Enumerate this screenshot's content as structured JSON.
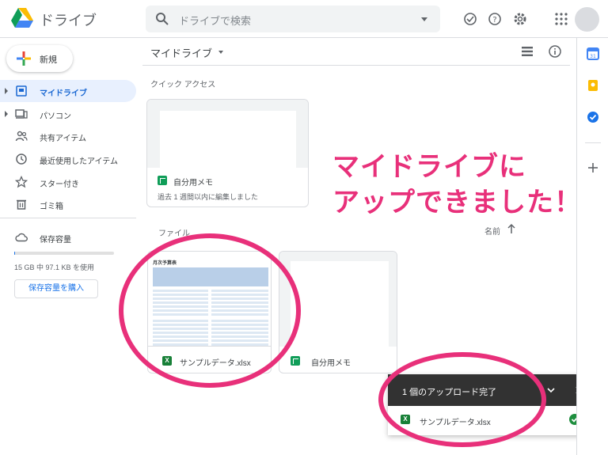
{
  "header": {
    "app_title": "ドライブ",
    "search_placeholder": "ドライブで検索"
  },
  "sidebar": {
    "new_label": "新規",
    "items": [
      {
        "label": "マイドライブ",
        "icon": "my-drive-icon"
      },
      {
        "label": "パソコン",
        "icon": "computer-icon"
      },
      {
        "label": "共有アイテム",
        "icon": "shared-icon"
      },
      {
        "label": "最近使用したアイテム",
        "icon": "recent-icon"
      },
      {
        "label": "スター付き",
        "icon": "star-icon"
      },
      {
        "label": "ゴミ箱",
        "icon": "trash-icon"
      },
      {
        "label": "保存容量",
        "icon": "cloud-icon"
      }
    ],
    "storage_text": "15 GB 中 97.1 KB を使用",
    "storage_used_fraction": 0.01,
    "buy_label": "保存容量を購入"
  },
  "main": {
    "title": "マイドライブ",
    "quick_access_label": "クイック アクセス",
    "quick_card": {
      "name": "自分用メモ",
      "subtitle": "過去 1 週間以内に編集しました"
    },
    "files_label": "ファイル",
    "sort_label": "名前",
    "files": [
      {
        "name": "サンプルデータ.xlsx",
        "type": "excel"
      },
      {
        "name": "自分用メモ",
        "type": "sheets"
      }
    ],
    "thumbnail_title": "月次予算表"
  },
  "callout": {
    "line1": "マイドライブに",
    "line2": "アップできました！",
    "color": "#e8307a"
  },
  "upload_panel": {
    "title": "1 個のアップロード完了",
    "file_name": "サンプルデータ.xlsx"
  }
}
